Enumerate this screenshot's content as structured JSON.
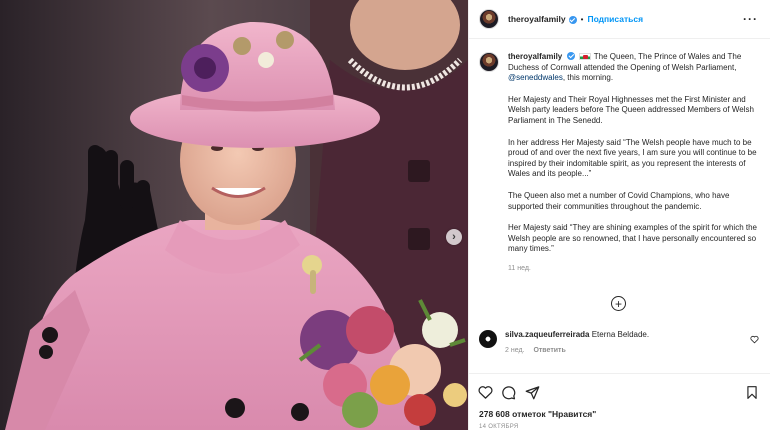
{
  "header": {
    "username": "theroyalfamily",
    "follow_label": "Подписаться",
    "separator": "•",
    "more_label": "···"
  },
  "caption": {
    "username": "theroyalfamily",
    "line1": "The Queen, The Prince of Wales and The Duchess of Cornwall attended the Opening of Welsh Parliament,",
    "mention": "@seneddwales",
    "line1_end": ", this morning.",
    "para2": "Her Majesty and Their Royal Highnesses met the First Minister and Welsh party leaders before The Queen addressed Members of Welsh Parliament in The Senedd.",
    "para3": "In her address Her Majesty said “The Welsh people have much to be proud of and over the next five years, I am sure you will continue to be inspired by their indomitable spirit, as you represent the interests of Wales and its people...”",
    "para4": "The Queen also met a number of Covid Champions, who have supported their communities throughout the pandemic.",
    "para5": "Her Majesty said “They are shining examples of the spirit for which the Welsh people are so renowned, that I have personally encountered so many times.”",
    "time": "11 нед."
  },
  "add_comments": "+",
  "comment": {
    "username": "silva.zaqueuferreirada",
    "text": "Eterna Beldade.",
    "time": "2 нед.",
    "reply_label": "Ответить"
  },
  "actions": {
    "likes": "278 608 отметок \"Нравится\"",
    "date": "14 ОКТЯБРЯ"
  },
  "media": {
    "next_label": "›"
  },
  "icons": [
    "more-icon",
    "verified-icon",
    "flag-icon",
    "add-circle-icon",
    "heart-icon",
    "comment-icon",
    "share-icon",
    "bookmark-icon",
    "chevron-right-icon"
  ],
  "colors": {
    "accent": "#0095f6",
    "mention": "#00376b",
    "muted": "#8e8e8e",
    "hat": "#e7a7bf",
    "coat": "#e19ab7"
  }
}
